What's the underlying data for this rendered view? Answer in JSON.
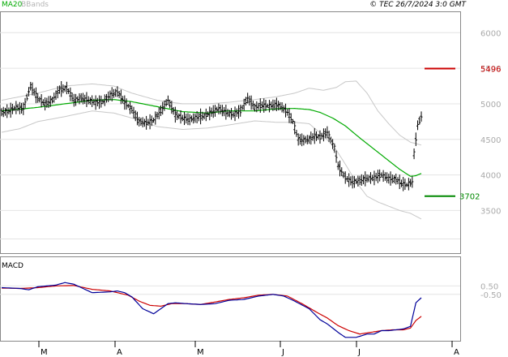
{
  "header": {
    "ma_label": "MA20",
    "bb_label": "BBands",
    "timestamp": "© TEC 26/7/2024 3:0 GMT"
  },
  "colors": {
    "ma": "#00aa00",
    "bbands": "#c8c8c8",
    "price": "#000000",
    "resistance": "#cc0000",
    "support": "#008800",
    "macd": "#000099",
    "signal": "#cc0000",
    "grid": "#e4e4e4"
  },
  "chart_data": [
    {
      "type": "ohlc",
      "ylim": [
        2900,
        6300
      ],
      "yticks": [
        {
          "value": 6000,
          "label": "6000"
        },
        {
          "value": 5500,
          "label": "5500"
        },
        {
          "value": 5000,
          "label": "5000"
        },
        {
          "value": 4500,
          "label": "4500"
        },
        {
          "value": 4000,
          "label": "4000"
        },
        {
          "value": 3500,
          "label": "3500"
        }
      ],
      "xticks": [
        "M",
        "A",
        "M",
        "J",
        "J",
        "A"
      ],
      "resistance": {
        "value": 5496,
        "label": "5496"
      },
      "support": {
        "value": 3702,
        "label": "3702"
      },
      "ma20_anchors": [
        [
          0,
          4900
        ],
        [
          20,
          4950
        ],
        [
          35,
          5000
        ],
        [
          50,
          5050
        ],
        [
          62,
          5060
        ],
        [
          72,
          5030
        ],
        [
          86,
          4960
        ],
        [
          100,
          4890
        ],
        [
          114,
          4870
        ],
        [
          125,
          4900
        ],
        [
          140,
          4900
        ],
        [
          152,
          4930
        ],
        [
          162,
          4935
        ],
        [
          170,
          4920
        ],
        [
          176,
          4880
        ],
        [
          183,
          4800
        ],
        [
          190,
          4690
        ],
        [
          198,
          4520
        ],
        [
          206,
          4360
        ],
        [
          214,
          4200
        ],
        [
          220,
          4080
        ],
        [
          226,
          3980
        ],
        [
          229,
          3990
        ],
        [
          232,
          4020
        ]
      ],
      "bb_upper_anchors": [
        [
          0,
          5050
        ],
        [
          10,
          5100
        ],
        [
          20,
          5150
        ],
        [
          35,
          5250
        ],
        [
          50,
          5280
        ],
        [
          62,
          5250
        ],
        [
          72,
          5150
        ],
        [
          86,
          5050
        ],
        [
          100,
          5000
        ],
        [
          114,
          5000
        ],
        [
          125,
          5020
        ],
        [
          140,
          5060
        ],
        [
          152,
          5100
        ],
        [
          162,
          5150
        ],
        [
          170,
          5220
        ],
        [
          178,
          5190
        ],
        [
          185,
          5230
        ],
        [
          190,
          5310
        ],
        [
          196,
          5320
        ],
        [
          202,
          5150
        ],
        [
          208,
          4900
        ],
        [
          214,
          4720
        ],
        [
          220,
          4560
        ],
        [
          226,
          4460
        ],
        [
          232,
          4420
        ]
      ],
      "bb_lower_anchors": [
        [
          0,
          4600
        ],
        [
          10,
          4650
        ],
        [
          20,
          4750
        ],
        [
          35,
          4820
        ],
        [
          50,
          4900
        ],
        [
          62,
          4870
        ],
        [
          72,
          4800
        ],
        [
          86,
          4680
        ],
        [
          100,
          4640
        ],
        [
          114,
          4660
        ],
        [
          125,
          4700
        ],
        [
          140,
          4760
        ],
        [
          152,
          4740
        ],
        [
          162,
          4740
        ],
        [
          170,
          4720
        ],
        [
          178,
          4550
        ],
        [
          185,
          4350
        ],
        [
          190,
          4150
        ],
        [
          196,
          3900
        ],
        [
          202,
          3700
        ],
        [
          208,
          3620
        ],
        [
          214,
          3560
        ],
        [
          220,
          3500
        ],
        [
          226,
          3460
        ],
        [
          232,
          3380
        ]
      ],
      "price_anchors": [
        [
          0,
          4880
        ],
        [
          4,
          4900
        ],
        [
          8,
          4950
        ],
        [
          12,
          4930
        ],
        [
          16,
          5250
        ],
        [
          20,
          5080
        ],
        [
          24,
          5000
        ],
        [
          28,
          5050
        ],
        [
          32,
          5200
        ],
        [
          36,
          5220
        ],
        [
          40,
          5050
        ],
        [
          44,
          5080
        ],
        [
          48,
          5050
        ],
        [
          52,
          5020
        ],
        [
          56,
          5030
        ],
        [
          60,
          5120
        ],
        [
          64,
          5170
        ],
        [
          68,
          5020
        ],
        [
          72,
          4920
        ],
        [
          76,
          4750
        ],
        [
          80,
          4730
        ],
        [
          84,
          4770
        ],
        [
          88,
          4900
        ],
        [
          92,
          5050
        ],
        [
          96,
          4850
        ],
        [
          100,
          4800
        ],
        [
          104,
          4780
        ],
        [
          108,
          4810
        ],
        [
          112,
          4830
        ],
        [
          116,
          4880
        ],
        [
          120,
          4930
        ],
        [
          124,
          4880
        ],
        [
          128,
          4850
        ],
        [
          132,
          4900
        ],
        [
          136,
          5080
        ],
        [
          140,
          4950
        ],
        [
          144,
          4980
        ],
        [
          148,
          4970
        ],
        [
          152,
          4990
        ],
        [
          155,
          4950
        ],
        [
          158,
          4880
        ],
        [
          161,
          4750
        ],
        [
          164,
          4500
        ],
        [
          167,
          4490
        ],
        [
          170,
          4500
        ],
        [
          173,
          4550
        ],
        [
          176,
          4530
        ],
        [
          180,
          4600
        ],
        [
          184,
          4380
        ],
        [
          186,
          4130
        ],
        [
          190,
          3960
        ],
        [
          194,
          3900
        ],
        [
          198,
          3920
        ],
        [
          202,
          3950
        ],
        [
          206,
          3960
        ],
        [
          210,
          4000
        ],
        [
          214,
          3950
        ],
        [
          218,
          3940
        ],
        [
          221,
          3880
        ],
        [
          224,
          3860
        ],
        [
          227,
          3900
        ],
        [
          228,
          4300
        ],
        [
          230,
          4700
        ],
        [
          232,
          4820
        ]
      ]
    },
    {
      "type": "line",
      "title": "MACD",
      "ylim": [
        -6,
        4
      ],
      "yticks": [
        {
          "value": 0.5,
          "label": "0.50"
        },
        {
          "value": -0.5,
          "label": "-0.50"
        }
      ],
      "macd_anchors": [
        [
          0,
          0.3
        ],
        [
          10,
          0.2
        ],
        [
          15,
          0.05
        ],
        [
          20,
          0.4
        ],
        [
          30,
          0.6
        ],
        [
          35,
          0.9
        ],
        [
          40,
          0.7
        ],
        [
          50,
          -0.3
        ],
        [
          60,
          -0.2
        ],
        [
          64,
          -0.1
        ],
        [
          68,
          -0.3
        ],
        [
          72,
          -0.8
        ],
        [
          78,
          -2.2
        ],
        [
          84,
          -2.8
        ],
        [
          88,
          -2.2
        ],
        [
          92,
          -1.6
        ],
        [
          96,
          -1.5
        ],
        [
          102,
          -1.6
        ],
        [
          110,
          -1.7
        ],
        [
          118,
          -1.6
        ],
        [
          126,
          -1.2
        ],
        [
          134,
          -1.1
        ],
        [
          142,
          -0.7
        ],
        [
          150,
          -0.5
        ],
        [
          156,
          -0.7
        ],
        [
          162,
          -1.3
        ],
        [
          170,
          -2.2
        ],
        [
          176,
          -3.5
        ],
        [
          180,
          -4.0
        ],
        [
          186,
          -5.0
        ],
        [
          190,
          -5.6
        ],
        [
          196,
          -5.6
        ],
        [
          202,
          -5.2
        ],
        [
          206,
          -5.2
        ],
        [
          210,
          -4.8
        ],
        [
          214,
          -4.8
        ],
        [
          218,
          -4.7
        ],
        [
          222,
          -4.6
        ],
        [
          226,
          -4.3
        ],
        [
          229,
          -1.5
        ],
        [
          232,
          -0.9
        ]
      ],
      "signal_anchors": [
        [
          0,
          0.25
        ],
        [
          10,
          0.2
        ],
        [
          20,
          0.3
        ],
        [
          30,
          0.5
        ],
        [
          40,
          0.55
        ],
        [
          50,
          0.1
        ],
        [
          60,
          -0.1
        ],
        [
          70,
          -0.6
        ],
        [
          76,
          -1.3
        ],
        [
          82,
          -1.8
        ],
        [
          88,
          -1.9
        ],
        [
          94,
          -1.6
        ],
        [
          102,
          -1.6
        ],
        [
          110,
          -1.7
        ],
        [
          118,
          -1.4
        ],
        [
          126,
          -1.1
        ],
        [
          134,
          -0.9
        ],
        [
          142,
          -0.6
        ],
        [
          150,
          -0.5
        ],
        [
          158,
          -0.7
        ],
        [
          166,
          -1.6
        ],
        [
          174,
          -2.6
        ],
        [
          180,
          -3.3
        ],
        [
          186,
          -4.2
        ],
        [
          192,
          -4.8
        ],
        [
          198,
          -5.2
        ],
        [
          204,
          -5.0
        ],
        [
          210,
          -4.8
        ],
        [
          216,
          -4.7
        ],
        [
          222,
          -4.7
        ],
        [
          226,
          -4.5
        ],
        [
          229,
          -3.6
        ],
        [
          232,
          -3.1
        ]
      ]
    }
  ]
}
